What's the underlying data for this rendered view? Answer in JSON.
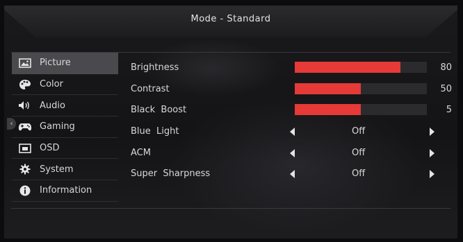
{
  "header": {
    "title": "Mode - Standard"
  },
  "sidebar": {
    "items": [
      {
        "label": "Picture",
        "icon": "picture-icon",
        "active": true
      },
      {
        "label": "Color",
        "icon": "palette-icon"
      },
      {
        "label": "Audio",
        "icon": "speaker-icon"
      },
      {
        "label": "Gaming",
        "icon": "gamepad-icon"
      },
      {
        "label": "OSD",
        "icon": "osd-icon"
      },
      {
        "label": "System",
        "icon": "gear-icon"
      },
      {
        "label": "Information",
        "icon": "info-icon"
      }
    ]
  },
  "settings": {
    "brightness": {
      "label": "Brightness",
      "value": "80",
      "level": 0.8
    },
    "contrast": {
      "label": "Contrast",
      "value": "50",
      "level": 0.5
    },
    "black_boost": {
      "label": "Black  Boost",
      "value": "5",
      "level": 0.5
    },
    "blue_light": {
      "label": "Blue  Light",
      "value": "Off"
    },
    "acm": {
      "label": "ACM",
      "value": "Off"
    },
    "super_sharpness": {
      "label": "Super  Sharpness",
      "value": "Off"
    }
  },
  "colors": {
    "accent": "#e53a37",
    "active_bg": "#4a4a4e"
  }
}
